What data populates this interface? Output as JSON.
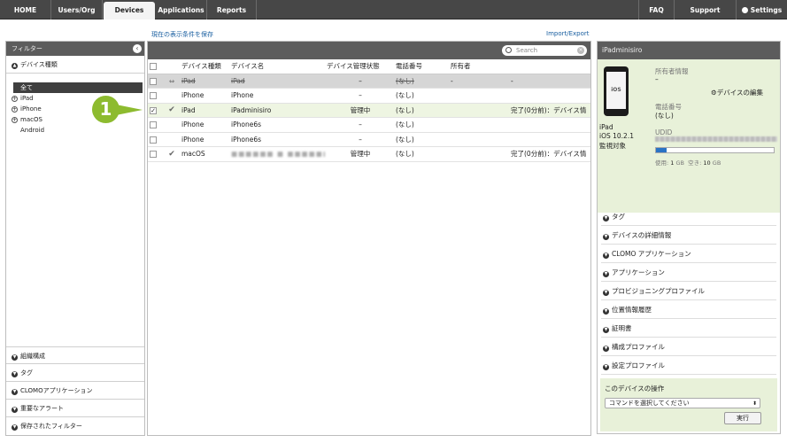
{
  "nav": {
    "tabs": [
      "HOME",
      "Users/Org",
      "Devices",
      "Applications",
      "Reports"
    ],
    "right": [
      "FAQ",
      "Support",
      "Settings"
    ]
  },
  "subbar": {
    "save_filter": "現在の表示条件を保存",
    "import_export": "Import/Export"
  },
  "filter": {
    "title": "フィルター",
    "device_type_section": "デバイス種類",
    "device_types": {
      "all": "全て",
      "items": [
        "iPad",
        "iPhone",
        "macOS",
        "Android"
      ]
    },
    "bottom_sections": [
      "組織構成",
      "タグ",
      "CLOMOアプリケーション",
      "重要なアラート",
      "保存されたフィルター"
    ]
  },
  "table": {
    "search_placeholder": "Search",
    "headers": [
      "デバイス種類",
      "デバイス名",
      "デバイス管理状態",
      "電話番号",
      "所有者",
      ""
    ],
    "rows": [
      {
        "type": "iPad",
        "name": "iPad",
        "status": "–",
        "phone": "(なし)",
        "owner": "-",
        "info": "-"
      },
      {
        "type": "iPhone",
        "name": "iPhone",
        "status": "–",
        "phone": "(なし)",
        "owner": "",
        "info": ""
      },
      {
        "type": "iPad",
        "name": "iPadminisiro",
        "status": "管理中",
        "phone": "(なし)",
        "owner": "",
        "info": "完了(0分前)：デバイス情"
      },
      {
        "type": "iPhone",
        "name": "iPhone6s",
        "status": "–",
        "phone": "(なし)",
        "owner": "",
        "info": ""
      },
      {
        "type": "iPhone",
        "name": "iPhone6s",
        "status": "–",
        "phone": "(なし)",
        "owner": "",
        "info": ""
      },
      {
        "type": "macOS",
        "name": "■■■■■■ ■ ■■■■■■",
        "status": "管理中",
        "phone": "(なし)",
        "owner": "",
        "info": "完了(0分前)：デバイス情"
      }
    ]
  },
  "badge": "1",
  "detail": {
    "title": "iPadminisiro",
    "screen": "iOS",
    "device_type": "iPad",
    "os": "iOS 10.2.1",
    "supervised": "監視対象",
    "owner_label": "所有者情報",
    "owner_value": "–",
    "edit_link": "デバイスの編集",
    "phone_label": "電話番号",
    "phone_value": "(なし)",
    "udid_label": "UDID",
    "storage": {
      "used_label": "使用:",
      "used_value": "1",
      "free_label": "空き:",
      "free_value": "10",
      "unit": "GB",
      "used_fraction": 0.09
    },
    "sections": [
      "タグ",
      "デバイスの詳細情報",
      "CLOMO アプリケーション",
      "アプリケーション",
      "プロビジョニングプロファイル",
      "位置情報履歴",
      "証明書",
      "構成プロファイル",
      "設定プロファイル"
    ],
    "action_title": "このデバイスの操作",
    "action_select": "コマンドを選択してください",
    "action_button": "実行"
  }
}
